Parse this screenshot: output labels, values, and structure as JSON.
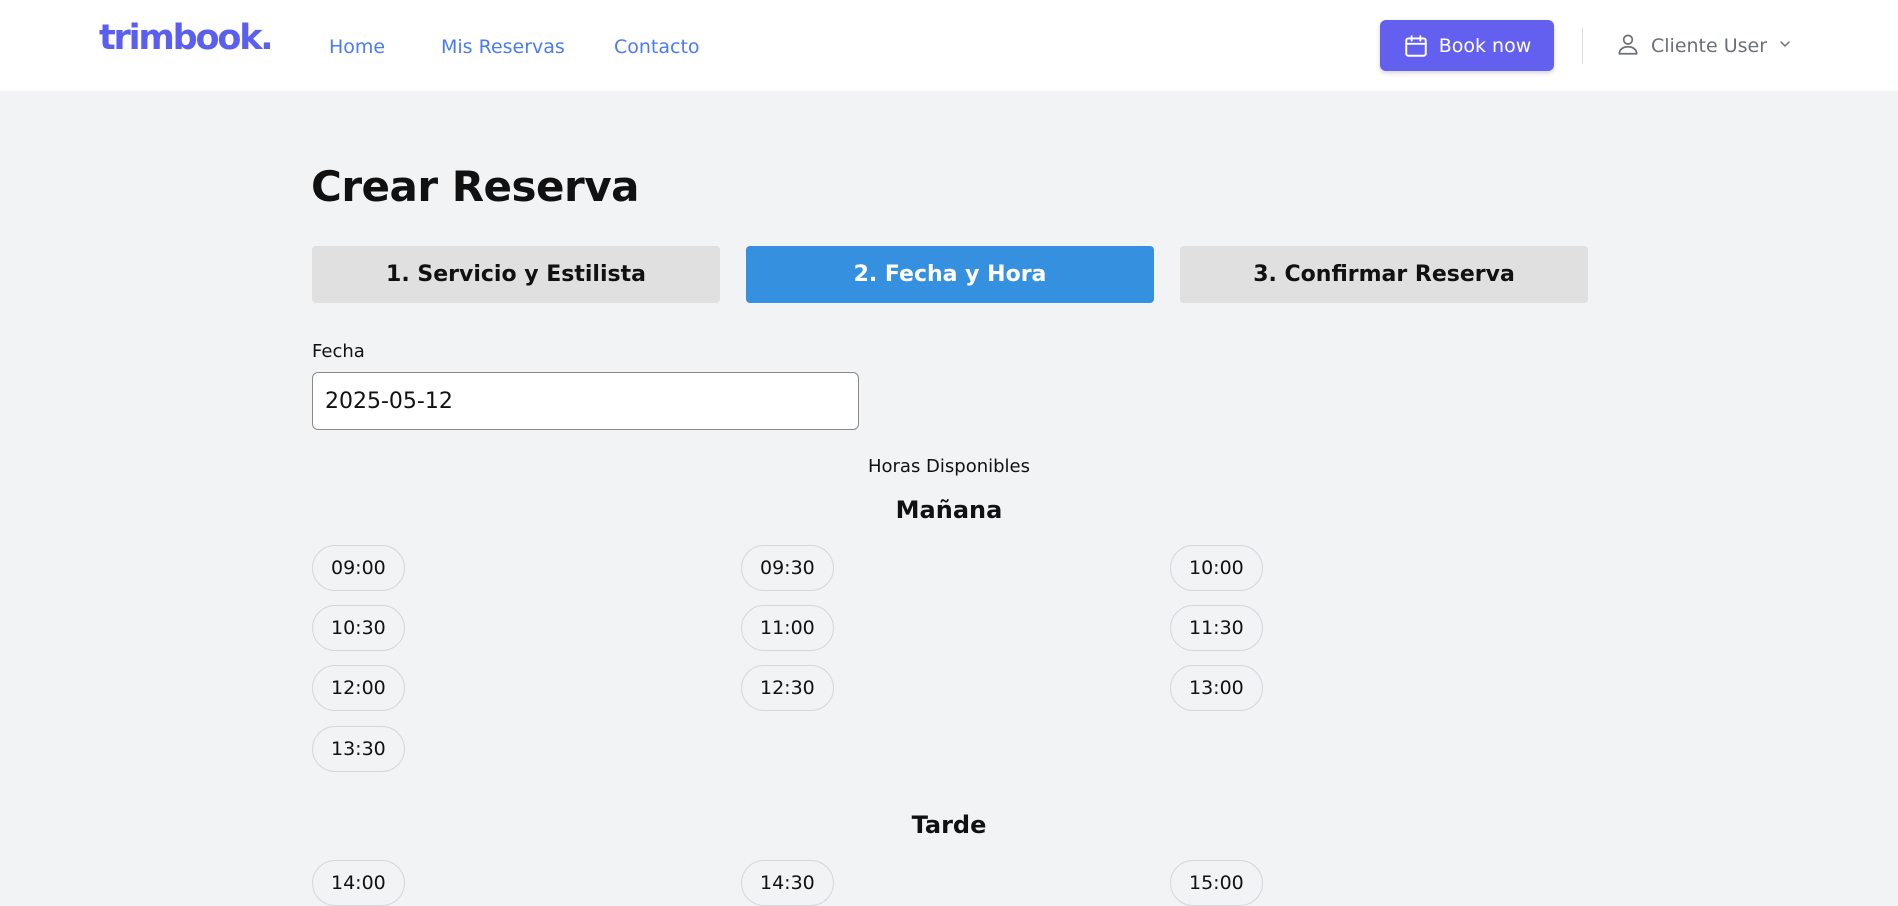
{
  "header": {
    "logo": "trimbook.",
    "nav": [
      "Home",
      "Mis Reservas",
      "Contacto"
    ],
    "book_now": "Book now",
    "user_name": "Cliente User",
    "accent_color": "#6360f0"
  },
  "page": {
    "title": "Crear Reserva",
    "steps": [
      "1. Servicio y Estilista",
      "2. Fecha y Hora",
      "3. Confirmar Reserva"
    ],
    "active_step": 2,
    "date_label": "Fecha",
    "date_value": "2025-05-12",
    "hours_title": "Horas Disponibles",
    "morning": {
      "title": "Mañana",
      "slots": [
        "09:00",
        "09:30",
        "10:00",
        "10:30",
        "11:00",
        "11:30",
        "12:00",
        "12:30",
        "13:00",
        "13:30"
      ]
    },
    "afternoon": {
      "title": "Tarde",
      "slots": [
        "14:00",
        "14:30",
        "15:00"
      ]
    }
  }
}
